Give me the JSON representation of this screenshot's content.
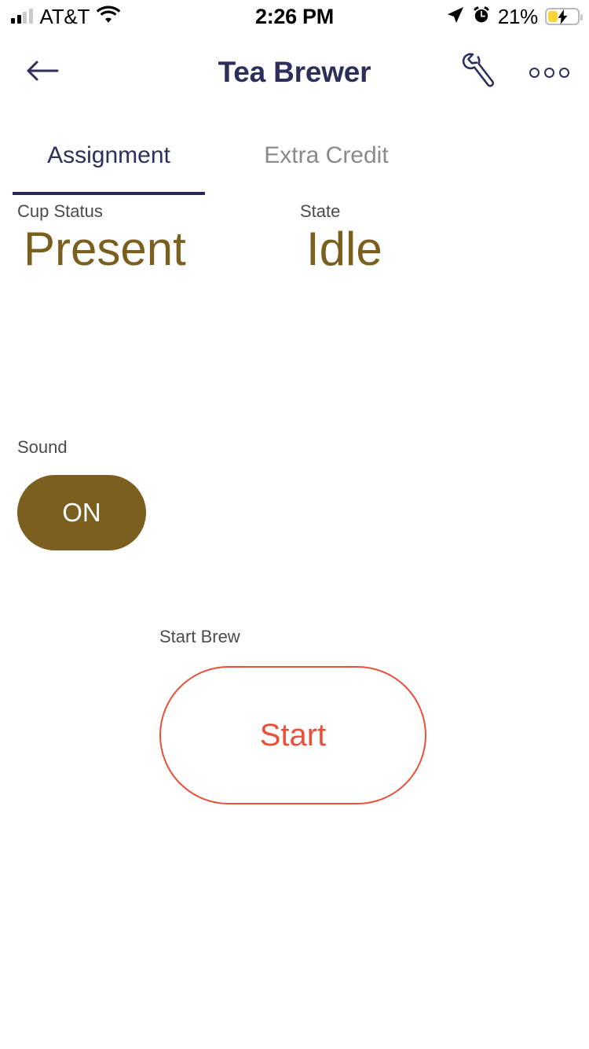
{
  "status_bar": {
    "carrier": "AT&T",
    "time": "2:26 PM",
    "battery_percent": "21%",
    "signal_bars_filled": 2,
    "signal_bars_total": 4,
    "wifi_icon": "wifi-icon",
    "location_icon": "location-arrow-icon",
    "alarm_icon": "alarm-clock-icon",
    "battery_icon": "battery-charging-icon",
    "battery_level": 21,
    "battery_charging": true,
    "battery_fill_color": "#fcd535"
  },
  "nav_bar": {
    "back_icon": "back-arrow-icon",
    "title": "Tea Brewer",
    "settings_icon": "wrench-icon",
    "overflow_icon": "more-horizontal-icon",
    "accent_color": "#2e2e5a"
  },
  "tabs": [
    {
      "label": "Assignment",
      "active": true
    },
    {
      "label": "Extra Credit",
      "active": false
    }
  ],
  "readouts": [
    {
      "label": "Cup Status",
      "value": "Present"
    },
    {
      "label": "State",
      "value": "Idle"
    }
  ],
  "sound": {
    "label": "Sound",
    "state": "ON",
    "fill_color": "#7a5f1e"
  },
  "start_brew": {
    "label": "Start Brew",
    "button_label": "Start",
    "accent_color": "#e8503a"
  },
  "theme": {
    "background": "#ffffff",
    "navy": "#2e2e5a",
    "brown": "#7a5f1e",
    "red": "#e8503a",
    "muted_text": "#4b4b4b",
    "inactive_tab": "#8a8a8a"
  }
}
